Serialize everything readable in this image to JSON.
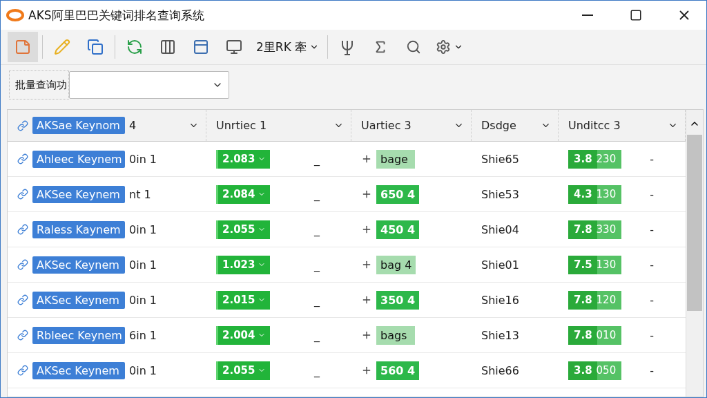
{
  "window": {
    "title": "AKS阿里巴巴关键词排名查询系统"
  },
  "toolbar": {
    "buttons": [
      {
        "selected": true
      },
      {
        "selected": false
      },
      {
        "selected": false
      },
      {
        "selected": false
      },
      {
        "selected": false
      },
      {
        "selected": false
      },
      {
        "selected": false
      }
    ],
    "menu_label": "2里RK 牽",
    "tools": [
      {
        "selected": false
      },
      {
        "selected": false
      },
      {
        "selected": false
      },
      {
        "selected": false
      }
    ]
  },
  "filter": {
    "label": "批量查询功"
  },
  "table": {
    "columns": [
      {
        "tag": "AKSae Keynom",
        "label": "4"
      },
      {
        "label": "Unrtiec 1"
      },
      {
        "label": "Uartiec 3"
      },
      {
        "label": "Dsdge"
      },
      {
        "label": "Unditcc 3"
      }
    ],
    "rows": [
      {
        "keyword": "Ahleec Keynem",
        "suffix": "0in 1",
        "score": "2.083",
        "mark_1": "_",
        "tag": "bage",
        "kind": "pale",
        "code": "Shie65",
        "rank": "3.8",
        "rank_count": "230",
        "mark_2": "-"
      },
      {
        "keyword": "AKSee Keynem",
        "suffix": "nt 1",
        "score": "2.084",
        "mark_1": "_",
        "tag": "650 4",
        "kind": "solid",
        "code": "Shie53",
        "rank": "4.3",
        "rank_count": "130",
        "mark_2": "-"
      },
      {
        "keyword": "Raless Kaynem",
        "suffix": "0in 1",
        "score": "2.055",
        "mark_1": "_",
        "tag": "450 4",
        "kind": "solid",
        "code": "Shie04",
        "rank": "7.8",
        "rank_count": "330",
        "mark_2": "-"
      },
      {
        "keyword": "AKSec Keynem",
        "suffix": "0in 1",
        "score": "1.023",
        "mark_1": "_",
        "tag": "bag 4",
        "kind": "pale",
        "code": "Shie01",
        "rank": "7.5",
        "rank_count": "130",
        "mark_2": "-"
      },
      {
        "keyword": "AKSec Keynem",
        "suffix": "0in 1",
        "score": "2.015",
        "mark_1": "_",
        "tag": "350 4",
        "kind": "solid",
        "code": "Shie16",
        "rank": "7.8",
        "rank_count": "120",
        "mark_2": "-"
      },
      {
        "keyword": "Rbleec Keynem",
        "suffix": "6in 1",
        "score": "2.004",
        "mark_1": "_",
        "tag": "bags",
        "kind": "pale",
        "code": "Shie13",
        "rank": "7.8",
        "rank_count": "010",
        "mark_2": "-"
      },
      {
        "keyword": "AKSec Keynem",
        "suffix": "0in 1",
        "score": "2.055",
        "mark_1": "_",
        "tag": "560 4",
        "kind": "solid",
        "code": "Shie66",
        "rank": "3.8",
        "rank_count": "050",
        "mark_2": "-"
      }
    ]
  }
}
